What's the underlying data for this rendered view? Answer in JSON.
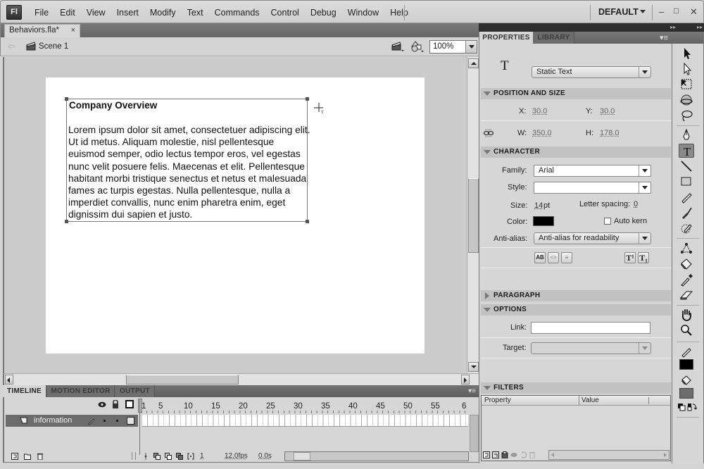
{
  "app": {
    "logo": "Fl",
    "menu": [
      "File",
      "Edit",
      "View",
      "Insert",
      "Modify",
      "Text",
      "Commands",
      "Control",
      "Debug",
      "Window",
      "Help"
    ],
    "workspace": "DEFAULT",
    "window_controls": {
      "minimize": "–",
      "maximize": "□",
      "close": "✕"
    }
  },
  "document": {
    "tab_title": "Behaviors.fla*",
    "close_glyph": "×",
    "scene": "Scene 1",
    "zoom": "100%"
  },
  "stage": {
    "heading": "Company Overview",
    "body": "Lorem ipsum dolor sit amet, consectetuer adipiscing elit. Ut id metus. Aliquam molestie, nisl pellentesque euismod semper, odio lectus tempor eros, vel egestas nunc velit posuere felis. Maecenas et elit. Pellentesque habitant morbi tristique senectus et netus et malesuada fames ac turpis egestas. Nulla pellentesque, nulla a imperdiet convallis, nunc enim pharetra enim, eget dignissim dui sapien et justo."
  },
  "timeline": {
    "tabs": [
      "TIMELINE",
      "MOTION EDITOR",
      "OUTPUT"
    ],
    "active_tab": "TIMELINE",
    "ruler_labels": [
      "1",
      "5",
      "10",
      "15",
      "20",
      "25",
      "30",
      "35",
      "40",
      "45",
      "50",
      "55",
      "6"
    ],
    "layers": [
      {
        "name": "information"
      }
    ],
    "current_frame": "1",
    "fps": "12.0fps",
    "elapsed": "0.0s"
  },
  "properties": {
    "tabs": [
      "PROPERTIES",
      "LIBRARY"
    ],
    "active_tab": "PROPERTIES",
    "tool_glyph": "T",
    "text_type": "Static Text",
    "position_size": {
      "title": "POSITION AND SIZE",
      "x_label": "X:",
      "x": "30.0",
      "y_label": "Y:",
      "y": "30.0",
      "w_label": "W:",
      "w": "350.0",
      "h_label": "H:",
      "h": "178.0"
    },
    "character": {
      "title": "CHARACTER",
      "family_label": "Family:",
      "family": "Arial",
      "style_label": "Style:",
      "style": "",
      "size_label": "Size:",
      "size": "14",
      "size_unit": "pt",
      "letter_spacing_label": "Letter spacing:",
      "letter_spacing": "0",
      "color_label": "Color:",
      "color": "#000000",
      "auto_kern_label": "Auto kern",
      "auto_kern": false,
      "anti_alias_label": "Anti-alias:",
      "anti_alias": "Anti-alias for readability",
      "format_buttons": [
        "AB",
        "<>",
        "≡"
      ],
      "script_buttons": [
        "T¹",
        "T₁"
      ]
    },
    "paragraph": {
      "title": "PARAGRAPH",
      "collapsed": true
    },
    "options": {
      "title": "OPTIONS",
      "link_label": "Link:",
      "link": "",
      "target_label": "Target:",
      "target": ""
    },
    "filters": {
      "title": "FILTERS",
      "columns": [
        "Property",
        "Value"
      ]
    }
  },
  "tools": [
    "selection",
    "subselection",
    "free-transform",
    "3d-rotation",
    "lasso",
    "pen",
    "text",
    "line",
    "rectangle",
    "pencil",
    "brush",
    "deco",
    "bone",
    "paint-bucket",
    "eyedropper",
    "eraser",
    "hand",
    "zoom"
  ],
  "colors": {
    "stroke": "#000000",
    "fill": "#6c6c6c"
  }
}
